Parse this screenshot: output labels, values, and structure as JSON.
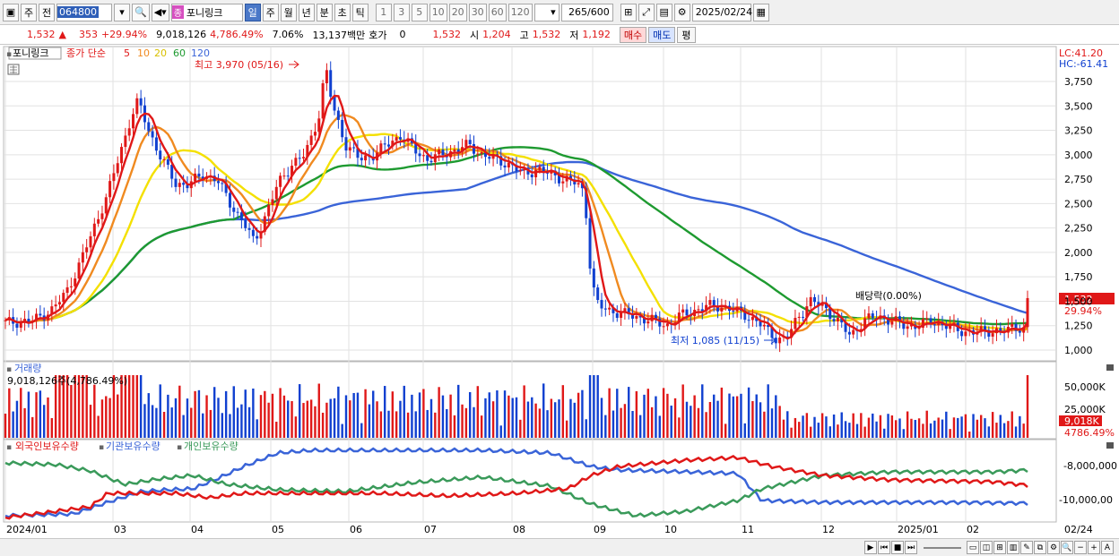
{
  "toolbar": {
    "type_label": "주",
    "period_label": "전",
    "stock_code": "064800",
    "stock_tag": "종",
    "stock_name": "포니링크",
    "periods": [
      "일",
      "주",
      "월",
      "년",
      "분",
      "초",
      "틱"
    ],
    "selected_period": "일",
    "intervals": [
      "1",
      "3",
      "5",
      "10",
      "20",
      "30",
      "60",
      "120"
    ],
    "bar_count": "265",
    "bar_total": "/600",
    "date": "2025/02/24"
  },
  "quote": {
    "price": "1,532",
    "change": "353",
    "change_pct": "+29.94%",
    "volume": "9,018,126",
    "volume_pct": "4,786.49%",
    "turnover_pct": "7.06%",
    "amount": "13,137백만",
    "bid_label": "호가",
    "bid_value": "0",
    "bid_price": "1,532",
    "open_label": "시",
    "open": "1,204",
    "high_label": "고",
    "high": "1,532",
    "low_label": "저",
    "low": "1,192",
    "buy_label": "매수",
    "sell_label": "매도",
    "eval_label": "평"
  },
  "price_panel": {
    "legend_name": "포니링크",
    "legend_ma_label": "종가 단순",
    "ma_periods": [
      "5",
      "10",
      "20",
      "60",
      "120"
    ],
    "lc_label": "LC:41.20",
    "hc_label": "HC:-61.41",
    "high_annot": "최고 3,970 (05/16)",
    "low_annot": "최저 1,085 (11/15)",
    "dividend_annot": "배당락(0.00%)",
    "last_price_tag": "1,532",
    "last_pct_tag": "29.94%",
    "y_ticks": [
      "3,750",
      "3,500",
      "3,250",
      "3,000",
      "2,750",
      "2,500",
      "2,250",
      "2,000",
      "1,750",
      "1,500",
      "1,250",
      "1,000"
    ]
  },
  "volume_panel": {
    "title": "거래량",
    "value_label": "9,018,126주(4,786.49%)",
    "y_ticks": [
      "50,000K",
      "25,000K"
    ],
    "last_tag": "9,018K",
    "last_pct_tag": "4786.49%"
  },
  "holdings_panel": {
    "legend": [
      "외국인보유수량",
      "기관보유수량",
      "개인보유수량"
    ],
    "y_ticks": [
      "-8,000,000",
      "-10,000,00"
    ]
  },
  "x_axis": {
    "labels": [
      "2024/01",
      "03",
      "04",
      "05",
      "06",
      "07",
      "08",
      "09",
      "10",
      "11",
      "12",
      "2025/01",
      "02"
    ],
    "right_label": "02/24"
  },
  "colors": {
    "up": "#e01818",
    "down": "#1040d0",
    "ma5": "#e01818",
    "ma10": "#f08a20",
    "ma20": "#f4e000",
    "ma60": "#1e9a30",
    "ma120": "#3a64d8",
    "foreign": "#e01818",
    "institution": "#3a64d8",
    "individual": "#3a9a5a"
  }
}
